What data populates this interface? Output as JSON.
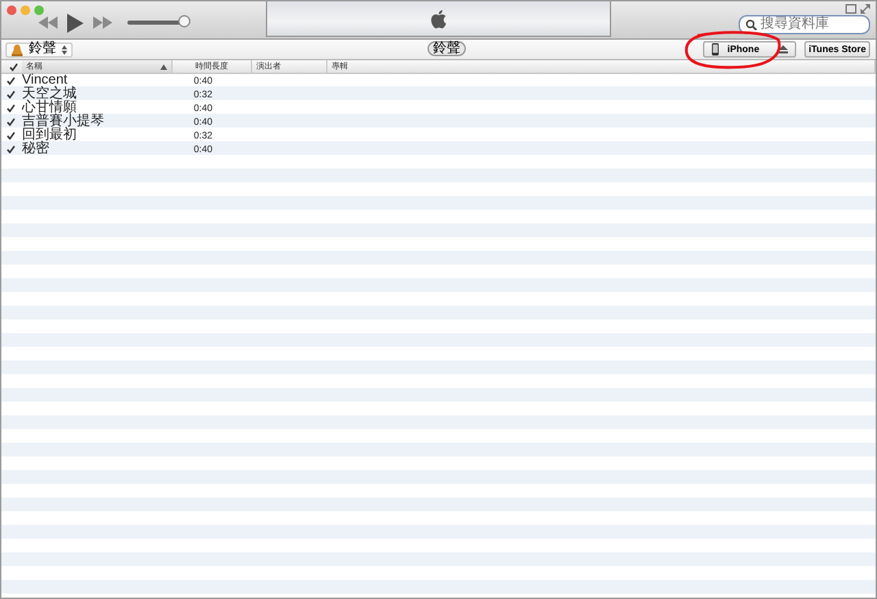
{
  "toolbar": {
    "search": {
      "placeholder": "搜尋資料庫"
    },
    "volume": {
      "level": 0.95
    }
  },
  "source_bar": {
    "library": "鈴聲",
    "center_tab": "鈴聲",
    "device": "iPhone",
    "store_button": "iTunes Store"
  },
  "table": {
    "columns": [
      {
        "label": "名稱",
        "sorted": true
      },
      {
        "label": "時間長度",
        "sorted": false
      },
      {
        "label": "演出者",
        "sorted": false
      },
      {
        "label": "專輯",
        "sorted": false
      }
    ],
    "rows": [
      {
        "checked": true,
        "name": "Vincent",
        "time": "0:40"
      },
      {
        "checked": true,
        "name": "天空之城",
        "time": "0:32"
      },
      {
        "checked": true,
        "name": "心甘情願",
        "time": "0:40"
      },
      {
        "checked": true,
        "name": "吉普賽小提琴",
        "time": "0:40"
      },
      {
        "checked": true,
        "name": "回到最初",
        "time": "0:32"
      },
      {
        "checked": true,
        "name": "秘密",
        "time": "0:40"
      }
    ]
  }
}
